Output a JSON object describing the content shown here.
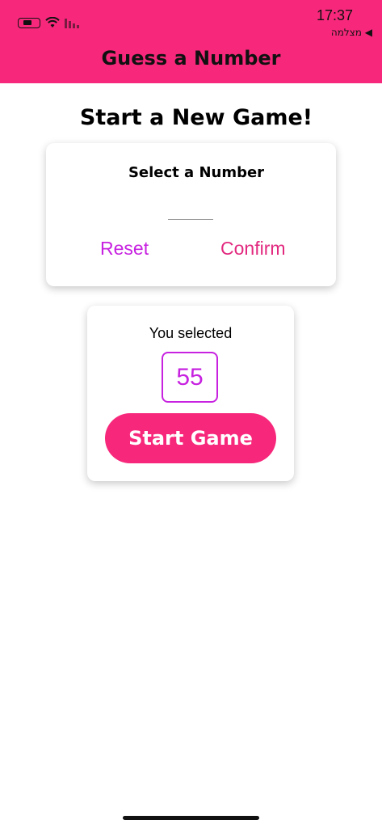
{
  "status_bar": {
    "time": "17:37",
    "back_label": "◀ מצלמה",
    "icons": [
      "battery-icon",
      "wifi-icon",
      "cellular-signal-icon"
    ]
  },
  "header": {
    "title": "Guess a Number",
    "background": "#f7287b"
  },
  "page": {
    "title": "Start a New Game!"
  },
  "select_card": {
    "label": "Select a Number",
    "input_value": "",
    "reset_label": "Reset",
    "confirm_label": "Confirm"
  },
  "selected_card": {
    "label": "You selected",
    "number": "55",
    "start_label": "Start Game"
  },
  "colors": {
    "primary": "#f7287b",
    "accent": "#c722e0"
  }
}
